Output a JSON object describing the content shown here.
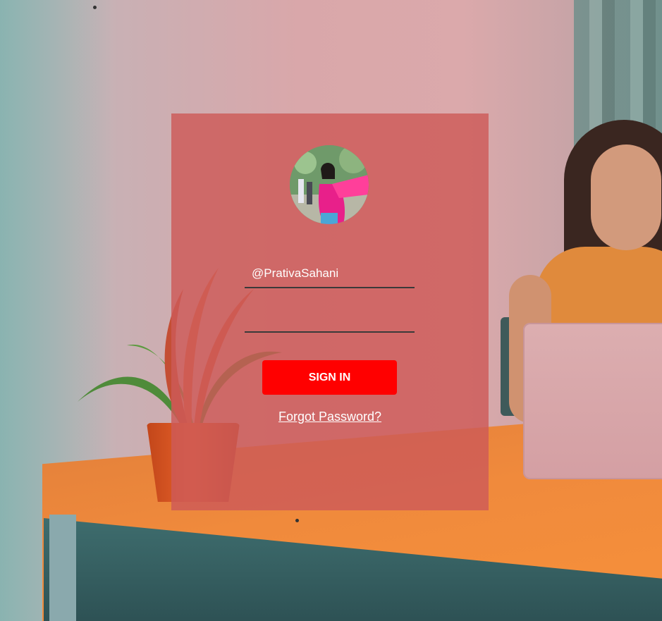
{
  "login": {
    "avatar_icon": "profile-photo",
    "username_value": "@PrativaSahani",
    "password_value": "",
    "signin_label": "SIGN IN",
    "forgot_label": "Forgot Password?"
  },
  "colors": {
    "card_background": "#cd5a58",
    "button": "#ff0000",
    "text": "#ffffff",
    "underline": "#3a3a3a"
  }
}
